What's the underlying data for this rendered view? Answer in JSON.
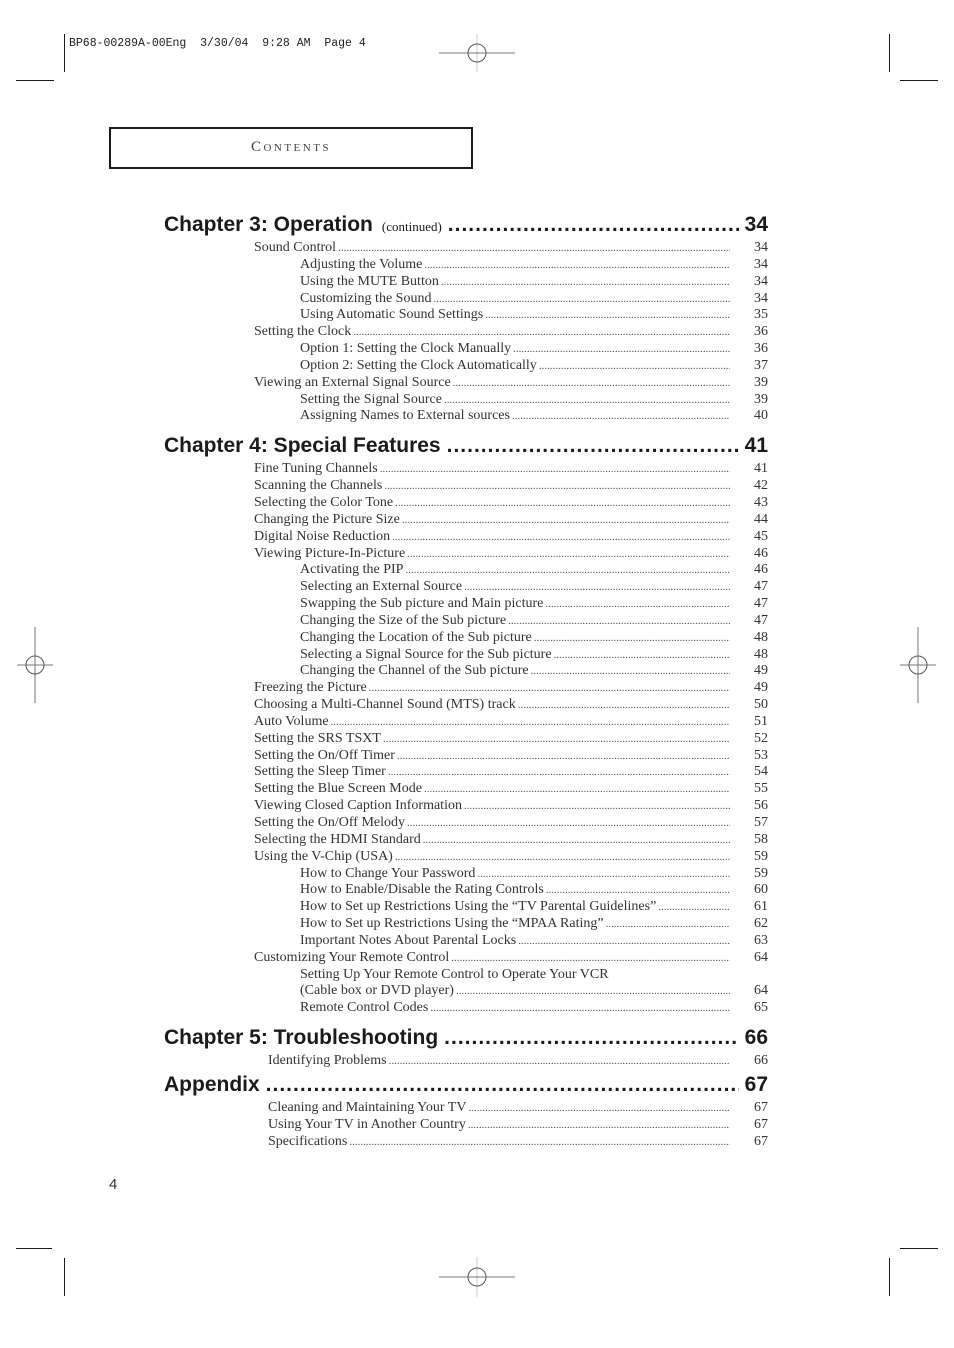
{
  "print_slug": "BP68-00289A-00Eng  3/30/04  9:28 AM  Page 4",
  "header": {
    "title": "Contents"
  },
  "toc": {
    "chapter3": {
      "title": "Chapter 3: Operation",
      "note": "(continued)",
      "page": "34",
      "entries": [
        {
          "title": "Sound Control",
          "page": "34",
          "level": 1
        },
        {
          "title": "Adjusting the Volume",
          "page": "34",
          "level": 2
        },
        {
          "title": "Using the MUTE Button",
          "page": "34",
          "level": 2
        },
        {
          "title": "Customizing the Sound",
          "page": "34",
          "level": 2
        },
        {
          "title": "Using Automatic Sound Settings",
          "page": "35",
          "level": 2
        },
        {
          "title": "Setting the Clock",
          "page": "36",
          "level": 1
        },
        {
          "title": "Option 1: Setting the Clock Manually",
          "page": "36",
          "level": 2
        },
        {
          "title": "Option 2: Setting the Clock Automatically",
          "page": "37",
          "level": 2
        },
        {
          "title": "Viewing an External Signal Source",
          "page": "39",
          "level": 1
        },
        {
          "title": "Setting the Signal Source",
          "page": "39",
          "level": 2
        },
        {
          "title": "Assigning Names to External sources",
          "page": "40",
          "level": 2
        }
      ]
    },
    "chapter4": {
      "title": "Chapter 4: Special Features",
      "page": "41",
      "entries": [
        {
          "title": "Fine Tuning Channels",
          "page": "41",
          "level": 1
        },
        {
          "title": "Scanning the Channels",
          "page": "42",
          "level": 1
        },
        {
          "title": "Selecting the Color Tone",
          "page": "43",
          "level": 1
        },
        {
          "title": "Changing the Picture Size",
          "page": "44",
          "level": 1
        },
        {
          "title": "Digital Noise Reduction",
          "page": "45",
          "level": 1
        },
        {
          "title": "Viewing Picture-In-Picture",
          "page": "46",
          "level": 1
        },
        {
          "title": "Activating the PIP",
          "page": "46",
          "level": 2
        },
        {
          "title": "Selecting an External Source",
          "page": "47",
          "level": 2
        },
        {
          "title": "Swapping the Sub picture and Main picture",
          "page": "47",
          "level": 2
        },
        {
          "title": "Changing the Size of the Sub picture",
          "page": "47",
          "level": 2
        },
        {
          "title": "Changing the Location of the Sub picture",
          "page": "48",
          "level": 2
        },
        {
          "title": "Selecting a Signal Source for the Sub picture",
          "page": "48",
          "level": 2
        },
        {
          "title": "Changing the Channel of the Sub picture",
          "page": "49",
          "level": 2
        },
        {
          "title": "Freezing the Picture",
          "page": "49",
          "level": 1
        },
        {
          "title": "Choosing a Multi-Channel Sound (MTS) track",
          "page": "50",
          "level": 1
        },
        {
          "title": "Auto Volume",
          "page": "51",
          "level": 1
        },
        {
          "title": "Setting the SRS TSXT",
          "page": "52",
          "level": 1
        },
        {
          "title": "Setting the On/Off Timer",
          "page": "53",
          "level": 1
        },
        {
          "title": "Setting the Sleep Timer",
          "page": "54",
          "level": 1
        },
        {
          "title": "Setting the Blue Screen Mode",
          "page": "55",
          "level": 1
        },
        {
          "title": "Viewing Closed Caption Information",
          "page": "56",
          "level": 1
        },
        {
          "title": "Setting the On/Off Melody",
          "page": "57",
          "level": 1
        },
        {
          "title": "Selecting the HDMI Standard",
          "page": "58",
          "level": 1
        },
        {
          "title": "Using the V-Chip (USA)",
          "page": "59",
          "level": 1
        },
        {
          "title": "How to Change Your Password",
          "page": "59",
          "level": 2
        },
        {
          "title": "How to Enable/Disable the Rating Controls",
          "page": "60",
          "level": 2
        },
        {
          "title": "How to Set up Restrictions Using the “TV Parental Guidelines”",
          "page": "61",
          "level": 2
        },
        {
          "title": "How to Set up Restrictions Using the “MPAA Rating”",
          "page": "62",
          "level": 2
        },
        {
          "title": "Important Notes About Parental Locks",
          "page": "63",
          "level": 2
        },
        {
          "title": "Customizing Your Remote Control",
          "page": "64",
          "level": 1
        },
        {
          "title": "Setting Up Your Remote Control to Operate Your VCR",
          "page": "",
          "level": 2
        },
        {
          "title": "(Cable box or DVD player)",
          "page": "64",
          "level": 2
        },
        {
          "title": "Remote Control Codes",
          "page": "65",
          "level": 2
        }
      ]
    },
    "chapter5": {
      "title": "Chapter 5: Troubleshooting",
      "page": "66",
      "entries": [
        {
          "title": "Identifying Problems",
          "page": "66",
          "level": 1
        }
      ]
    },
    "appendix": {
      "title": "Appendix",
      "page": "67",
      "entries": [
        {
          "title": "Cleaning and Maintaining Your TV",
          "page": "67",
          "level": 1
        },
        {
          "title": "Using Your TV in Another Country",
          "page": "67",
          "level": 1
        },
        {
          "title": "Specifications",
          "page": "67",
          "level": 1
        }
      ]
    }
  },
  "footer": {
    "page_number": "4"
  }
}
